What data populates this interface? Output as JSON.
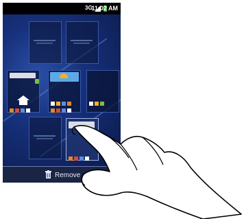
{
  "status_bar": {
    "time": "11:02 AM",
    "network": "3G",
    "icons": [
      "3g-icon",
      "signal-icon",
      "battery-icon"
    ]
  },
  "screens_editor": {
    "thumbnails": [
      {
        "row": 1,
        "col": 1,
        "content": "empty"
      },
      {
        "row": 1,
        "col": 2,
        "content": "empty"
      },
      {
        "row": 2,
        "col": 1,
        "content": "home-with-shortcuts"
      },
      {
        "row": 2,
        "col": 2,
        "content": "weather-widget"
      },
      {
        "row": 2,
        "col": 3,
        "content": "icons"
      },
      {
        "row": 3,
        "col": 1,
        "content": "empty"
      },
      {
        "row": 3,
        "col": 2,
        "content": "dragged-screen"
      }
    ]
  },
  "remove_bar": {
    "label": "Remove"
  },
  "colors": {
    "accent": "#2a4fa6",
    "status_bar": "#000000",
    "battery": "#45b845",
    "remove_bar": "#1a2444"
  }
}
